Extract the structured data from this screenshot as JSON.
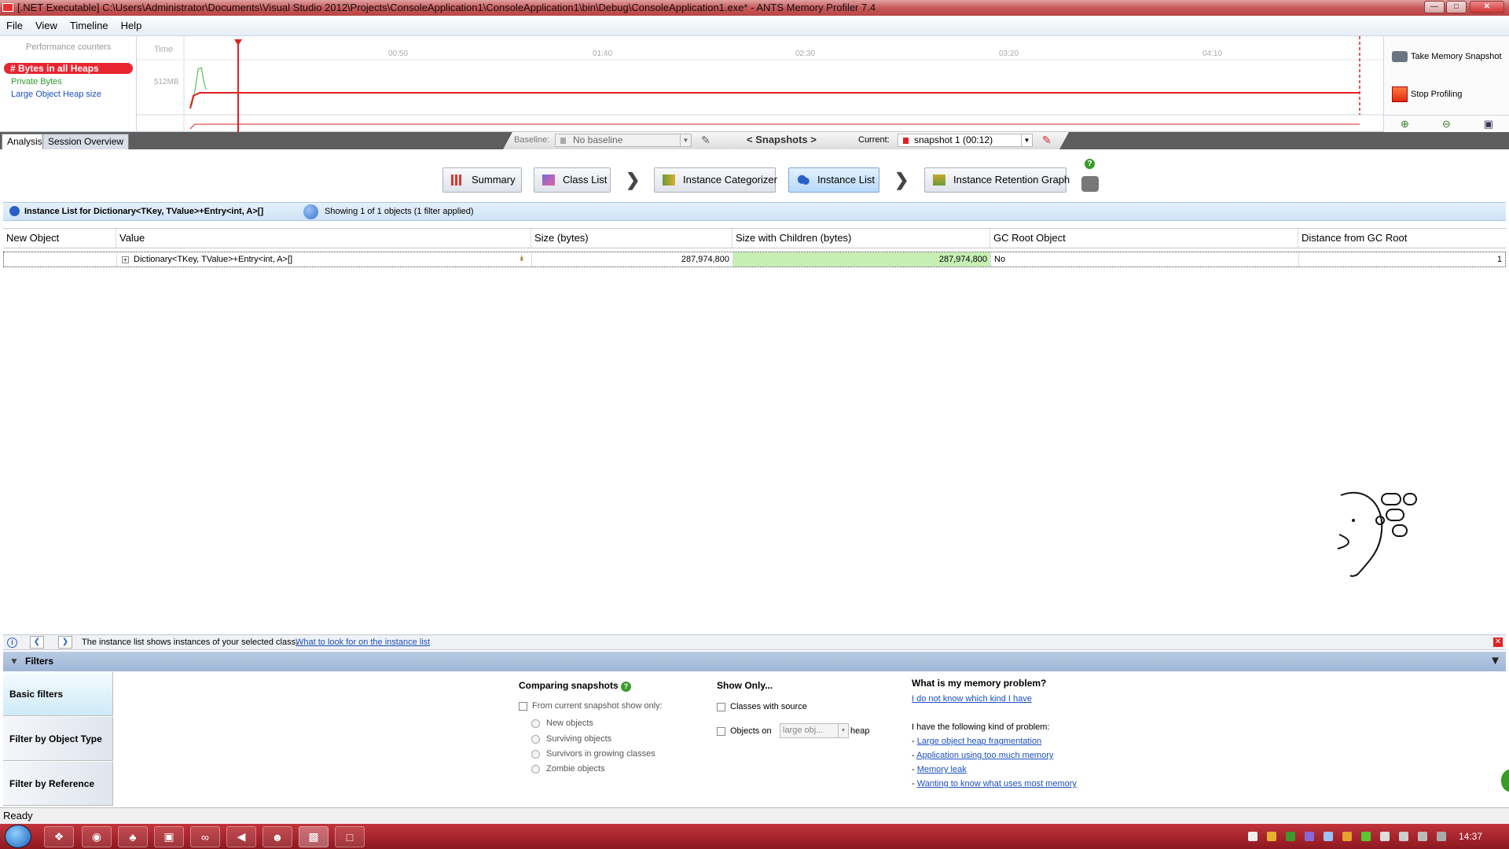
{
  "window": {
    "title": "[.NET Executable] C:\\Users\\Administrator\\Documents\\Visual Studio 2012\\Projects\\ConsoleApplication1\\ConsoleApplication1\\bin\\Debug\\ConsoleApplication1.exe* - ANTS Memory Profiler 7.4"
  },
  "menu": {
    "file": "File",
    "view": "View",
    "timeline": "Timeline",
    "help": "Help"
  },
  "perf": {
    "header": "Performance counters",
    "counters": [
      "# Bytes in all Heaps",
      "Private Bytes",
      "Large Object Heap size"
    ],
    "time_label": "Time",
    "y_label": "512MB",
    "ticks": [
      "00:50",
      "01:40",
      "02:30",
      "03:20",
      "04:10"
    ],
    "take_snapshot": "Take Memory Snapshot",
    "stop_profiling": "Stop Profiling"
  },
  "tabs": {
    "analysis": "Analysis",
    "session": "Session Overview"
  },
  "snapbar": {
    "baseline_label": "Baseline:",
    "baseline_value": "No baseline",
    "snapshots": "< Snapshots >",
    "current_label": "Current:",
    "current_value": "snapshot 1 (00:12)"
  },
  "nav": {
    "summary": "Summary",
    "class_list": "Class List",
    "instance_categorizer": "Instance Categorizer",
    "instance_list": "Instance List",
    "retention_graph": "Instance Retention Graph"
  },
  "list_header": {
    "title": "Instance List for Dictionary<TKey, TValue>+Entry<int, A>[]",
    "showing": "Showing 1 of 1 objects (1 filter applied)"
  },
  "grid": {
    "columns": [
      "New Object",
      "Value",
      "Size (bytes)",
      "Size with Children (bytes)",
      "GC Root Object",
      "Distance from GC Root"
    ],
    "rows": [
      {
        "new": "",
        "value": "Dictionary<TKey, TValue>+Entry<int, A>[]",
        "size": "287,974,800",
        "size_children": "287,974,800",
        "gc_root": "No",
        "distance": "1"
      }
    ]
  },
  "infobar": {
    "text": "The instance list shows instances of your selected class.",
    "link": "What to look for on the instance list"
  },
  "filters": {
    "title": "Filters",
    "tabs": [
      "Basic filters",
      "Filter by Object Type",
      "Filter by Reference"
    ],
    "comparing": {
      "heading": "Comparing snapshots",
      "checkbox": "From current snapshot show only:",
      "options": [
        "New objects",
        "Surviving objects",
        "Survivors in growing classes",
        "Zombie objects"
      ]
    },
    "show_only": {
      "heading": "Show Only...",
      "classes_with_source": "Classes with source",
      "objects_on": "Objects on",
      "heap_select": "large obj...",
      "heap": "heap"
    },
    "problem": {
      "heading": "What is my memory problem?",
      "unknown_link": "I do not know which kind I have",
      "kinds_label": "I have the following kind of problem:",
      "links": [
        "Large object heap fragmentation",
        "Application using too much memory",
        "Memory leak",
        "Wanting to know what uses most memory"
      ]
    }
  },
  "status": {
    "text": "Ready"
  },
  "taskbar": {
    "clock": "14:37"
  },
  "colors": {
    "accent_red": "#e8252f",
    "highlight_green": "#c6efb4",
    "active_nav": "#b8d8f8"
  }
}
